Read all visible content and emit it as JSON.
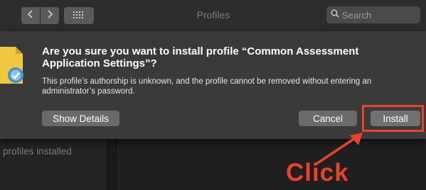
{
  "window": {
    "title": "Profiles"
  },
  "toolbar": {
    "back_icon": "chevron-left-icon",
    "forward_icon": "chevron-right-icon",
    "grid_icon": "grid-icon",
    "search_placeholder": "Search"
  },
  "dialog": {
    "icon": "certificate-icon",
    "title": "Are you sure you want to install profile “Common Assessment Application Settings”?",
    "message": "This profile’s authorship is unknown, and the profile cannot be removed without entering an administrator’s password.",
    "show_details_label": "Show Details",
    "cancel_label": "Cancel",
    "install_label": "Install"
  },
  "background": {
    "profiles_installed_text": "profiles installed"
  },
  "annotation": {
    "label": "Click",
    "color": "#e8432a"
  }
}
